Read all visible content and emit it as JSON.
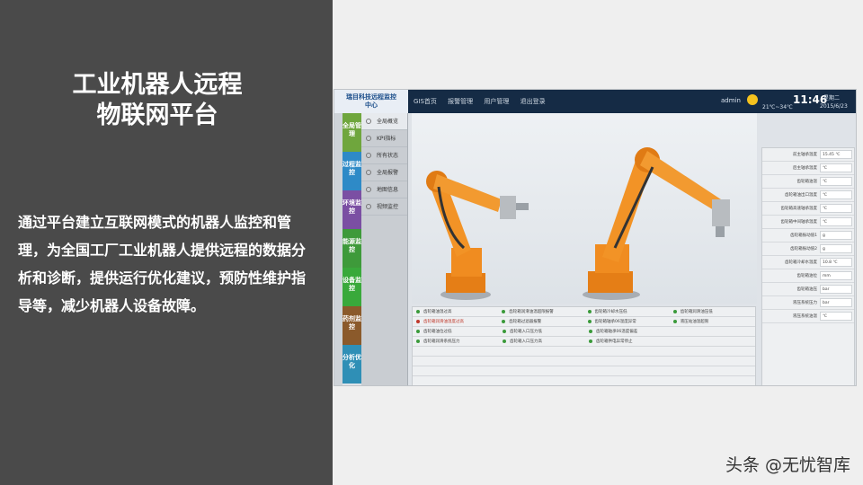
{
  "slide": {
    "title_line1": "工业机器人远程",
    "title_line2": "物联网平台",
    "description": "通过平台建立互联网模式的机器人监控和管理，为全国工厂工业机器人提供远程的数据分析和诊断，提供运行优化建议，预防性维护指导等，减少机器人设备故障。",
    "watermark": "头条 @无忧智库"
  },
  "app": {
    "brand_line1": "瑞目科技远程监控",
    "brand_line2": "中心",
    "nav": [
      "GIS首页",
      "报警管理",
      "用户管理",
      "退出登录"
    ],
    "user": "admin",
    "weather": {
      "temp": "21℃~34℃",
      "icon": "sun-icon"
    },
    "time": "11:46",
    "week": "星期二",
    "date": "2015/6/23",
    "colors": {
      "topbar": "#152b45",
      "accent": "#f28a1c"
    },
    "categories": [
      {
        "label": "全局管理",
        "color": "#6fa63d"
      },
      {
        "label": "过程监控",
        "color": "#2e8ac7"
      },
      {
        "label": "环境监控",
        "color": "#7b4fa3"
      },
      {
        "label": "能源监控",
        "color": "#3e9a3a"
      },
      {
        "label": "设备监控",
        "color": "#39a93b"
      },
      {
        "label": "药剂监控",
        "color": "#8b5a2b"
      },
      {
        "label": "分析优化",
        "color": "#2f8fb6"
      }
    ],
    "menu": [
      "全局概览",
      "KPI指标",
      "所有状态",
      "全局报警",
      "地图信息",
      "视频监控"
    ],
    "alarms": [
      [
        "齿轮箱油温过高",
        "齿轮箱润滑油温超限报警",
        "齿轮箱冷却水压低",
        "齿轮箱润滑油压低"
      ],
      [
        "齿轮箱润滑油温度过高",
        "齿轮箱过滤器报警",
        "齿轮箱轴承06温度异常",
        "液压站油温超限"
      ],
      [
        "齿轮箱油位过低",
        "齿轮箱入口压力低",
        "齿轮箱轴承06温度偏差",
        ""
      ],
      [
        "齿轮箱润滑系统压力",
        "齿轮箱入口压力高",
        "齿轮箱供电异常停止",
        ""
      ]
    ],
    "params": [
      {
        "label": "前主轴承温度",
        "value": "15.45 ℃"
      },
      {
        "label": "后主轴承温度",
        "value": "℃"
      },
      {
        "label": "齿轮箱油温",
        "value": "℃"
      },
      {
        "label": "齿轮箱油出口温度",
        "value": "℃"
      },
      {
        "label": "齿轮箱高速轴承温度",
        "value": "℃"
      },
      {
        "label": "齿轮箱中间轴承温度",
        "value": "℃"
      },
      {
        "label": "齿轮箱振动值1",
        "value": "g"
      },
      {
        "label": "齿轮箱振动值2",
        "value": "g"
      },
      {
        "label": "齿轮箱冷却水温度",
        "value": "10.8 ℃"
      },
      {
        "label": "齿轮箱油位",
        "value": "mm"
      },
      {
        "label": "齿轮箱油压",
        "value": "bar"
      },
      {
        "label": "液压系统压力",
        "value": "bar"
      },
      {
        "label": "液压系统油温",
        "value": "℃"
      }
    ]
  }
}
